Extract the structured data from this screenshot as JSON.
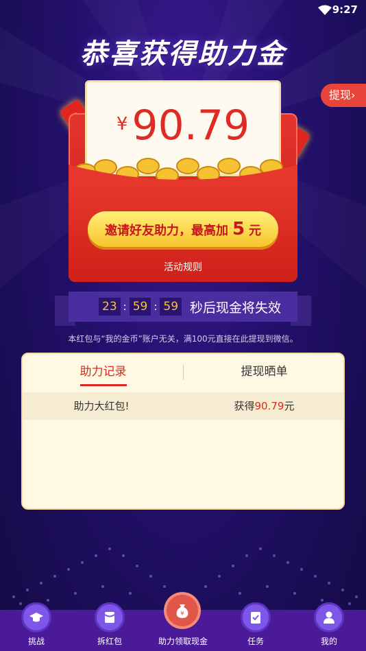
{
  "status_bar": {
    "time": "9:27",
    "wifi_icon": "wifi-icon"
  },
  "headline": "恭喜获得助力金",
  "withdraw_button": {
    "label": "提现",
    "chevron": "›"
  },
  "red_packet": {
    "currency": "¥",
    "amount": "90.79",
    "invite_button": {
      "prefix": "邀请好友助力，最高加",
      "highlight": "5",
      "suffix": "元"
    },
    "rules_link": "活动规则"
  },
  "countdown": {
    "hours": "23",
    "minutes": "59",
    "seconds": "59",
    "separator": ":",
    "message": "秒后现金将失效"
  },
  "notice": "本红包与“我的金币”账户无关，满100元直接在此提现到微信。",
  "records_panel": {
    "tabs": [
      {
        "label": "助力记录",
        "active": true
      },
      {
        "label": "提现晒单",
        "active": false
      }
    ],
    "rows": [
      {
        "title": "助力大红包!",
        "prefix": "获得",
        "amount": "90.79",
        "unit": "元"
      }
    ]
  },
  "bottom_nav": {
    "items": [
      {
        "label": "挑战",
        "icon": "graduation-cap-icon"
      },
      {
        "label": "拆红包",
        "icon": "red-packet-icon"
      },
      {
        "label": "助力领取现金",
        "icon": "money-bag-icon",
        "active": true
      },
      {
        "label": "任务",
        "icon": "clipboard-check-icon"
      },
      {
        "label": "我的",
        "icon": "user-icon"
      }
    ]
  },
  "colors": {
    "accent_red": "#e02a25",
    "gold": "#f7c52c",
    "nav_purple": "#4a1a99",
    "background": "#22106a"
  }
}
